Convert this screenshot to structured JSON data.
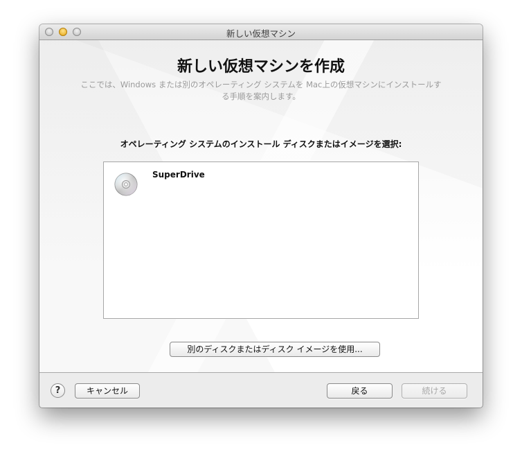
{
  "window": {
    "title": "新しい仮想マシン"
  },
  "main": {
    "heading": "新しい仮想マシンを作成",
    "subtitle_line1": "ここでは、Windows または別のオペレーティング システムを Mac上の仮想マシンにインストールす",
    "subtitle_line2": "る手順を案内します。",
    "prompt": "オペレーティング システムのインストール ディスクまたはイメージを選択:",
    "list": [
      {
        "label": "SuperDrive",
        "icon": "optical-disc-icon"
      }
    ],
    "other_disc_button": "別のディスクまたはディスク イメージを使用..."
  },
  "footer": {
    "help_label": "?",
    "cancel_label": "キャンセル",
    "back_label": "戻る",
    "continue_label": "続ける",
    "continue_enabled": false
  }
}
